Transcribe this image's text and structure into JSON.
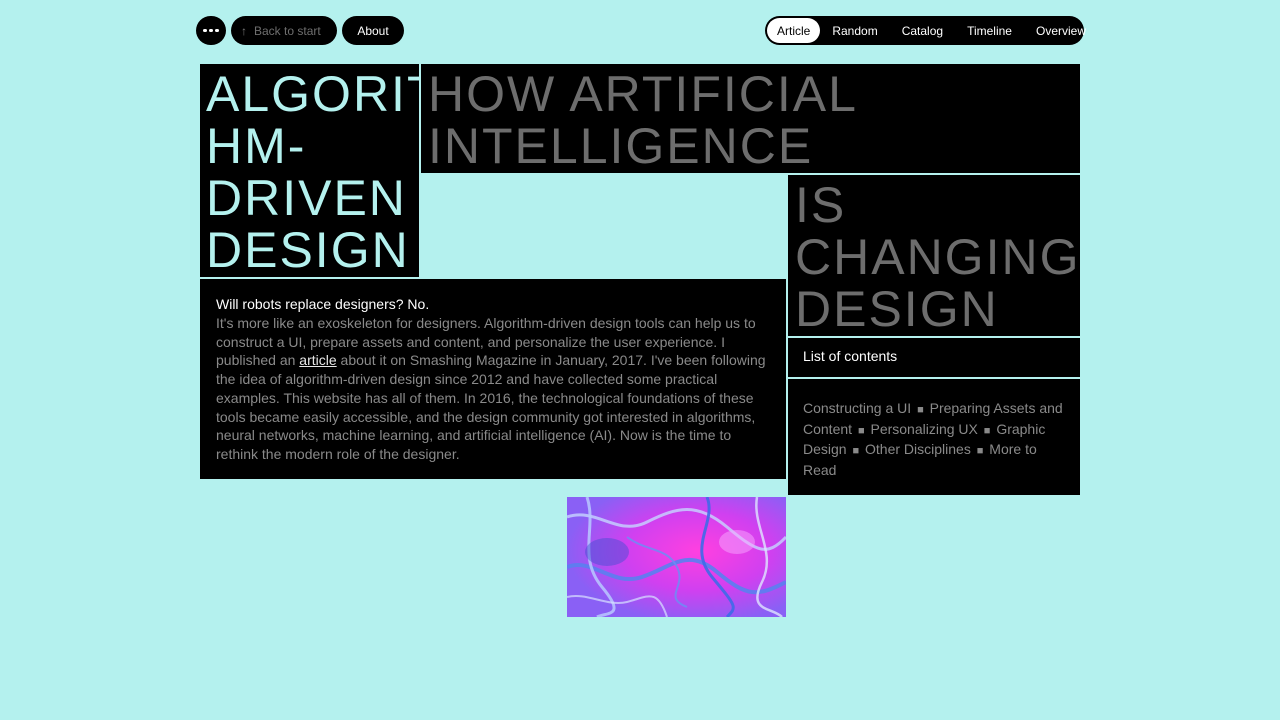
{
  "header": {
    "back_label": "Back to start",
    "about_label": "About",
    "nav_tabs": [
      {
        "label": "Article",
        "active": true
      },
      {
        "label": "Random",
        "active": false
      },
      {
        "label": "Catalog",
        "active": false
      },
      {
        "label": "Timeline",
        "active": false
      },
      {
        "label": "Overview",
        "active": false
      }
    ]
  },
  "hero": {
    "title_lines": [
      "ALGORIT",
      "HM-",
      "DRIVEN",
      "DESIGN"
    ],
    "subtitle_lines_1": [
      "HOW ARTIFICIAL",
      "INTELLIGENCE"
    ],
    "subtitle_lines_2": [
      "IS",
      "CHANGING",
      "DESIGN"
    ]
  },
  "intro": {
    "lead": "Will robots replace designers? No.",
    "body_before": "It's more like an exoskeleton for designers. Algorithm-driven design tools can help us to construct a UI, prepare assets and content, and personalize the user experience. I published an ",
    "link_text": "article",
    "body_after": " about it on Smashing Magazine in January, 2017. I've been following the idea of algorithm-driven design since 2012 and have collected some practical examples. This website has all of them. In 2016, the technological foundations of these tools became easily accessible, and the design community got interested in algorithms, neural networks, machine learning, and artificial intelligence (AI). Now is the time to rethink the modern role of the designer."
  },
  "contents": {
    "title": "List of contents",
    "items": [
      "Constructing a UI",
      "Preparing Assets and Content",
      "Personalizing UX",
      "Graphic Design",
      "Other Disciplines",
      "More to Read"
    ],
    "separator": "■"
  },
  "colors": {
    "background": "#b4f1ee",
    "block": "#000000",
    "accent_text": "#b4f1ee",
    "muted_text": "#6d6d6d"
  },
  "icons": {
    "menu": "dots-icon",
    "back": "arrow-up-icon"
  }
}
